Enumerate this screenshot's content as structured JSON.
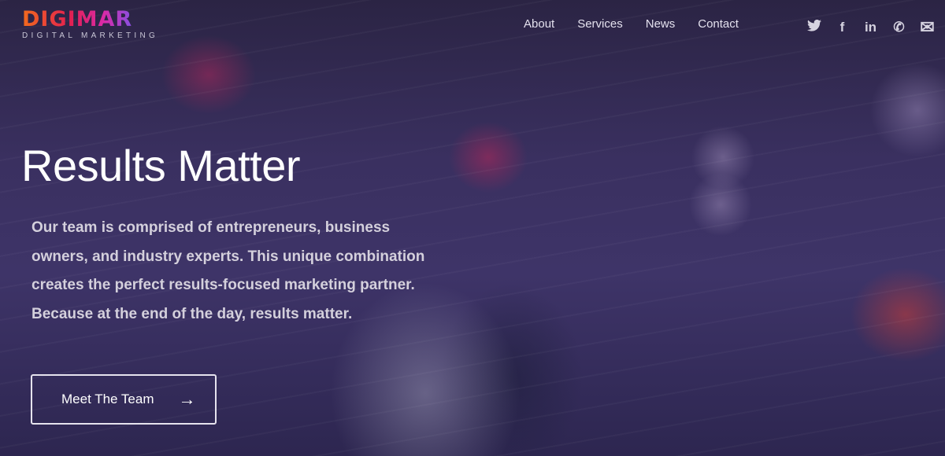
{
  "logo": {
    "name": "DIGIMAR",
    "tagline": "DIGITAL MARKETING"
  },
  "nav": [
    {
      "label": "About"
    },
    {
      "label": "Services"
    },
    {
      "label": "News"
    },
    {
      "label": "Contact"
    }
  ],
  "social": [
    {
      "icon": "twitter-icon",
      "glyph": "🐦"
    },
    {
      "icon": "facebook-icon",
      "glyph": "f"
    },
    {
      "icon": "linkedin-icon",
      "glyph": "in"
    },
    {
      "icon": "phone-icon",
      "glyph": "✆"
    },
    {
      "icon": "envelope-icon",
      "glyph": "✉"
    }
  ],
  "hero": {
    "title": "Results Matter",
    "text": "Our team is comprised of entrepreneurs, business owners, and industry experts. This unique combination creates the perfect results-focused marketing partner. Because at the end of the day, results matter.",
    "button_label": "Meet The Team",
    "button_icon": "→"
  }
}
